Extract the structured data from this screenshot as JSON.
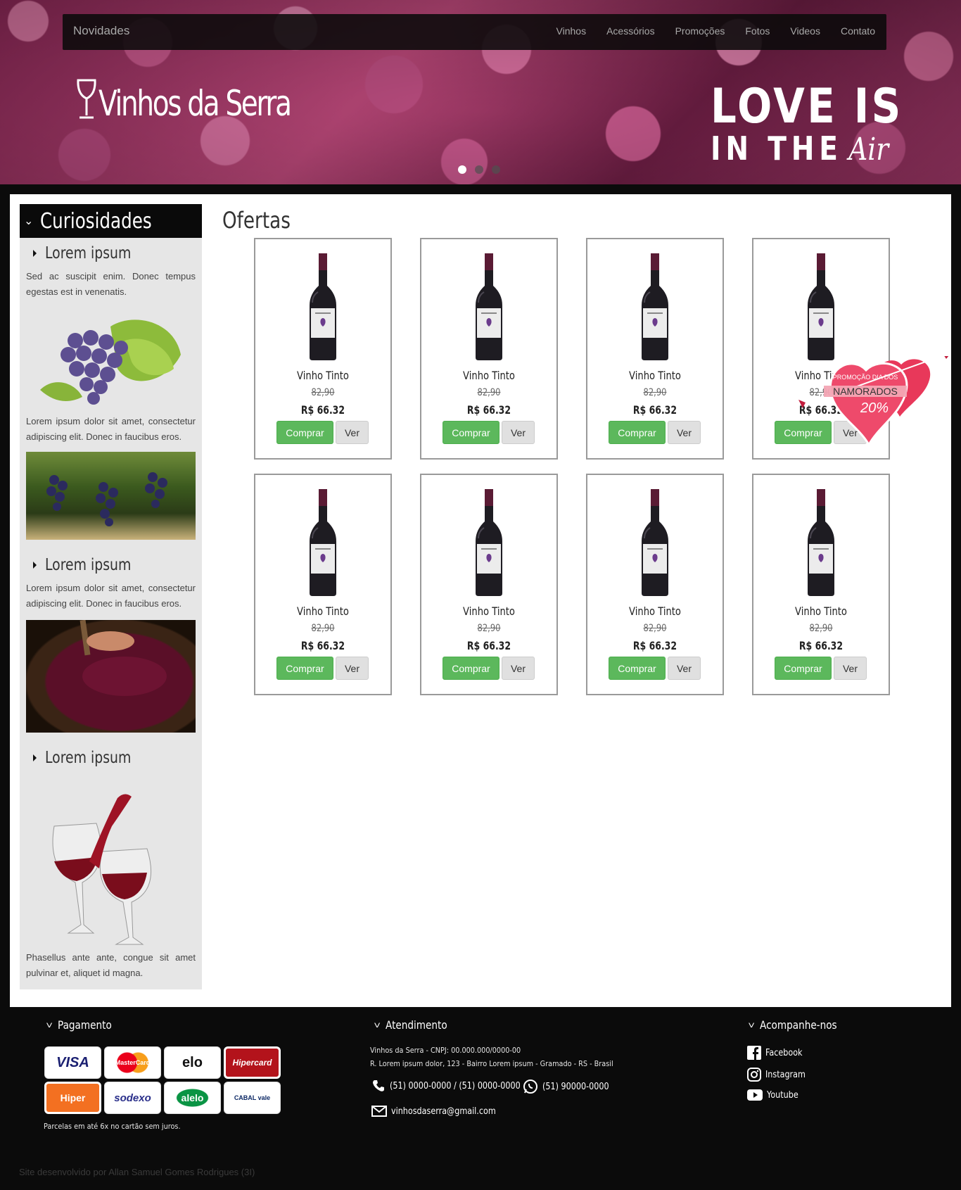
{
  "nav": {
    "brand": "Novidades",
    "items": [
      "Vinhos",
      "Acessórios",
      "Promoções",
      "Fotos",
      "Videos",
      "Contato"
    ]
  },
  "hero": {
    "logo_text": "Vinhos da Serra",
    "slogan_line1": "LOVE IS",
    "slogan_line2": "IN THE",
    "slogan_word": "Air",
    "badge_line1": "PROMOÇÃO DIA DOS",
    "badge_line2": "NAMORADOS",
    "badge_line3": "20%",
    "slides": 3,
    "active_slide": 1
  },
  "sidebar": {
    "title": "Curiosidades",
    "sections": [
      {
        "title": "Lorem ipsum",
        "text1": "Sed ac suscipit enim. Donec tempus egestas est in venenatis.",
        "text2": "Lorem ipsum dolor sit amet, consectetur adipiscing elit. Donec in faucibus eros."
      },
      {
        "title": "Lorem ipsum",
        "text1": "Lorem ipsum dolor sit amet, consectetur adipiscing elit. Donec in faucibus eros."
      },
      {
        "title": "Lorem ipsum",
        "text1": "Phasellus ante ante, congue sit amet pulvinar et, aliquet id magna."
      }
    ]
  },
  "offers": {
    "title": "Ofertas",
    "products": [
      {
        "name": "Vinho Tinto",
        "old_price": "82,90",
        "price": "R$ 66.32",
        "buy": "Comprar",
        "see": "Ver"
      },
      {
        "name": "Vinho Tinto",
        "old_price": "82,90",
        "price": "R$ 66.32",
        "buy": "Comprar",
        "see": "Ver"
      },
      {
        "name": "Vinho Tinto",
        "old_price": "82,90",
        "price": "R$ 66.32",
        "buy": "Comprar",
        "see": "Ver"
      },
      {
        "name": "Vinho Tinto",
        "old_price": "82,90",
        "price": "R$ 66.32",
        "buy": "Comprar",
        "see": "Ver"
      },
      {
        "name": "Vinho Tinto",
        "old_price": "82,90",
        "price": "R$ 66.32",
        "buy": "Comprar",
        "see": "Ver"
      },
      {
        "name": "Vinho Tinto",
        "old_price": "82,90",
        "price": "R$ 66.32",
        "buy": "Comprar",
        "see": "Ver"
      },
      {
        "name": "Vinho Tinto",
        "old_price": "82,90",
        "price": "R$ 66.32",
        "buy": "Comprar",
        "see": "Ver"
      },
      {
        "name": "Vinho Tinto",
        "old_price": "82,90",
        "price": "R$ 66.32",
        "buy": "Comprar",
        "see": "Ver"
      }
    ]
  },
  "footer": {
    "payment_title": "Pagamento",
    "payment_cards": [
      "VISA",
      "MasterCard",
      "elo",
      "Hipercard",
      "Hiper",
      "sodexo",
      "alelo",
      "CABAL vale"
    ],
    "installments": "Parcelas em até 6x no cartão sem juros.",
    "service_title": "Atendimento",
    "company": "Vinhos da Serra - CNPJ: 00.000.000/0000-00",
    "address": "R. Lorem ipsum dolor, 123 - Bairro Lorem ipsum - Gramado - RS - Brasil",
    "phones": "(51) 0000-0000 / (51) 0000-0000",
    "whatsapp": "(51) 90000-0000",
    "email": "vinhosdaserra@gmail.com",
    "follow_title": "Acompanhe-nos",
    "social": [
      "Facebook",
      "Instagram",
      "Youtube"
    ],
    "credit": "Site desenvolvido por Allan Samuel Gomes Rodrigues (3I)"
  },
  "colors": {
    "buy_button": "#5cb85c",
    "see_button": "#e0e0e0",
    "sidebar_bg": "#e6e6e6",
    "page_bg": "#0b0b0b"
  }
}
